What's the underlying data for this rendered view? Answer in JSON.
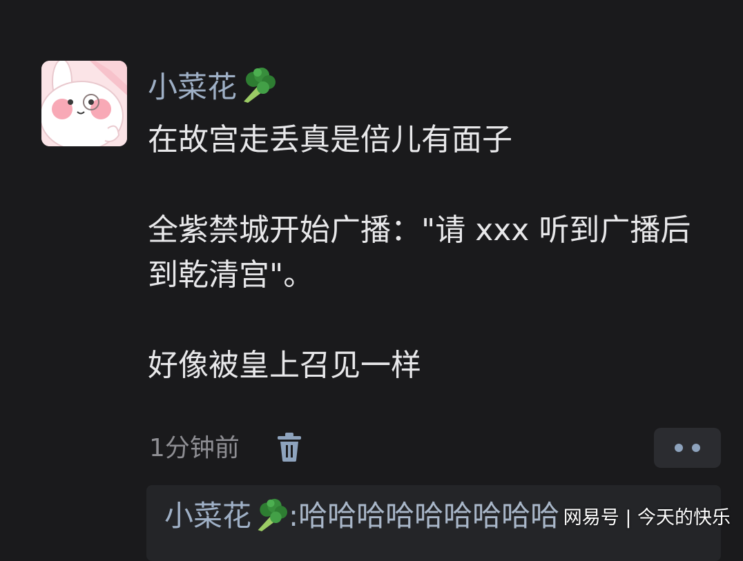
{
  "post": {
    "username": "小菜花",
    "username_emoji": "broccoli",
    "paragraphs": [
      "在故宫走丢真是倍儿有面子",
      "全紫禁城开始广播：\"请 xxx 听到广播后到乾清宫\"。",
      "好像被皇上召见一样"
    ],
    "timestamp": "1分钟前",
    "delete_icon": "trash-icon",
    "more_icon": "more-dots-icon"
  },
  "reply": {
    "username": "小菜花",
    "username_emoji": "broccoli",
    "separator": ":",
    "text": "哈哈哈哈哈哈哈哈哈"
  },
  "watermark": "网易号 | 今天的快乐",
  "colors": {
    "background": "#1a1a1c",
    "username": "#9fb0c6",
    "body_text": "#e8e8ea",
    "meta_text": "#8e8e93",
    "button_bg": "#2b2c30",
    "reply_bg": "#242528"
  }
}
